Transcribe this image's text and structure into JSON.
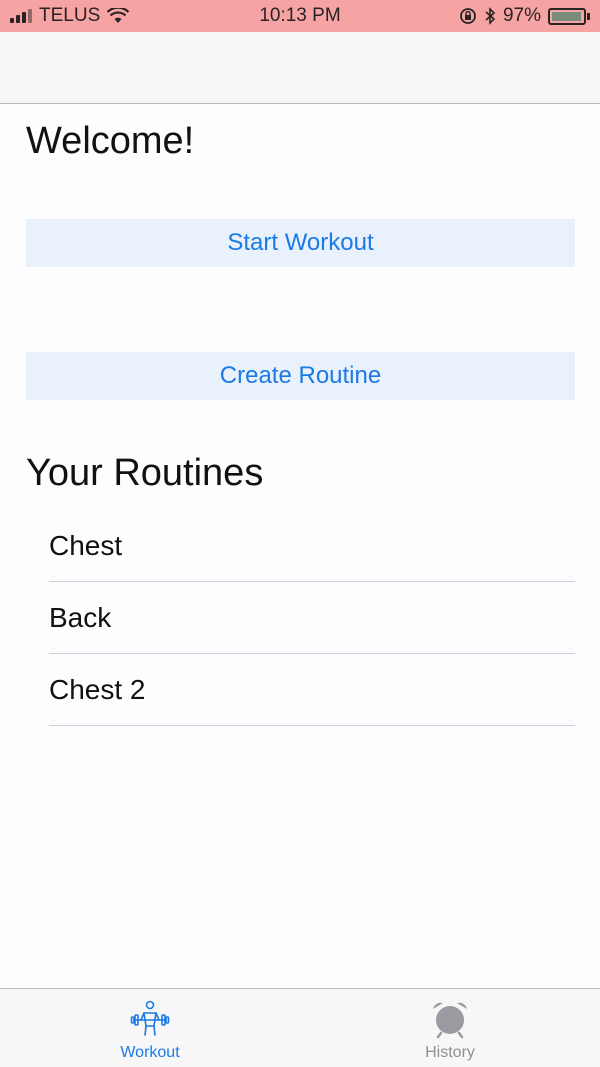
{
  "status_bar": {
    "carrier": "TELUS",
    "time": "10:13 PM",
    "battery_percent": "97%",
    "battery_level": 0.97,
    "icons": [
      "signal-icon",
      "wifi-icon",
      "orientation-lock-icon",
      "bluetooth-icon",
      "battery-icon"
    ]
  },
  "main": {
    "welcome": "Welcome!",
    "start_workout_label": "Start Workout",
    "create_routine_label": "Create Routine",
    "routines_title": "Your Routines",
    "routines": [
      "Chest",
      "Back",
      "Chest 2"
    ]
  },
  "tab_bar": {
    "tabs": [
      {
        "label": "Workout",
        "icon": "weightlifter-icon",
        "active": true
      },
      {
        "label": "History",
        "icon": "alarm-clock-icon",
        "active": false
      }
    ]
  },
  "colors": {
    "accent": "#1a7ae6",
    "button_bg": "#e9f1fd",
    "status_bar_bg": "#f6a3a3",
    "inactive_tab": "#8e8e93"
  }
}
